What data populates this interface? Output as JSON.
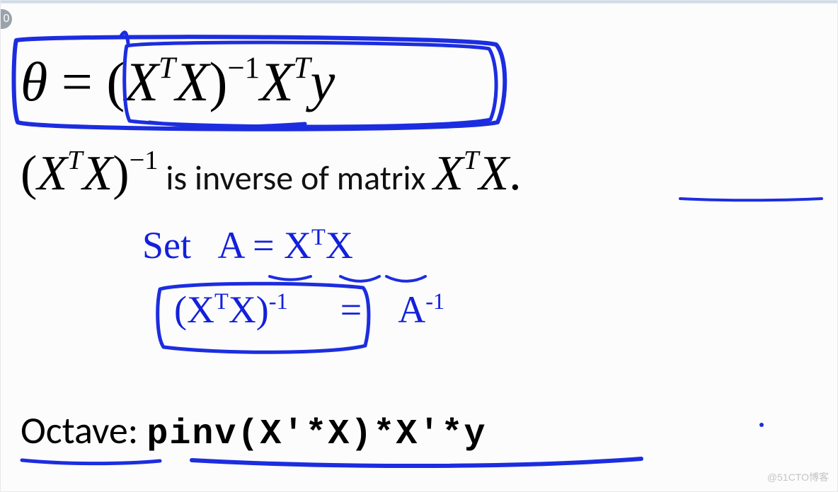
{
  "corner_badge": "0",
  "equation": {
    "theta": "θ",
    "equals": " = ",
    "lpar": "(",
    "X1": "X",
    "T1": "T",
    "X2": "X",
    "rpar": ")",
    "neg1": "−1",
    "X3": "X",
    "T2": "T",
    "y": "y"
  },
  "explain": {
    "lpar": "(",
    "X1": "X",
    "T1": "T",
    "X2": "X",
    "rpar": ")",
    "neg1": "−1",
    "text": " is inverse of matrix ",
    "X3": "X",
    "T2": "T",
    "X4": "X",
    "dot": "."
  },
  "hw_set": {
    "set": "Set",
    "A": "A",
    "eq": " = ",
    "X1": "X",
    "T": "T",
    "X2": "X"
  },
  "hw_inv": {
    "lpar": "(",
    "X1": "X",
    "T": "T",
    "X2": "X",
    "rpar": ")",
    "neg1": "-1",
    "eq": " = ",
    "A": "A",
    "neg1b": "-1"
  },
  "octave": {
    "label": "Octave: ",
    "code": "pinv(X'*X)*X'*y"
  },
  "watermark": "@51CTO博客"
}
